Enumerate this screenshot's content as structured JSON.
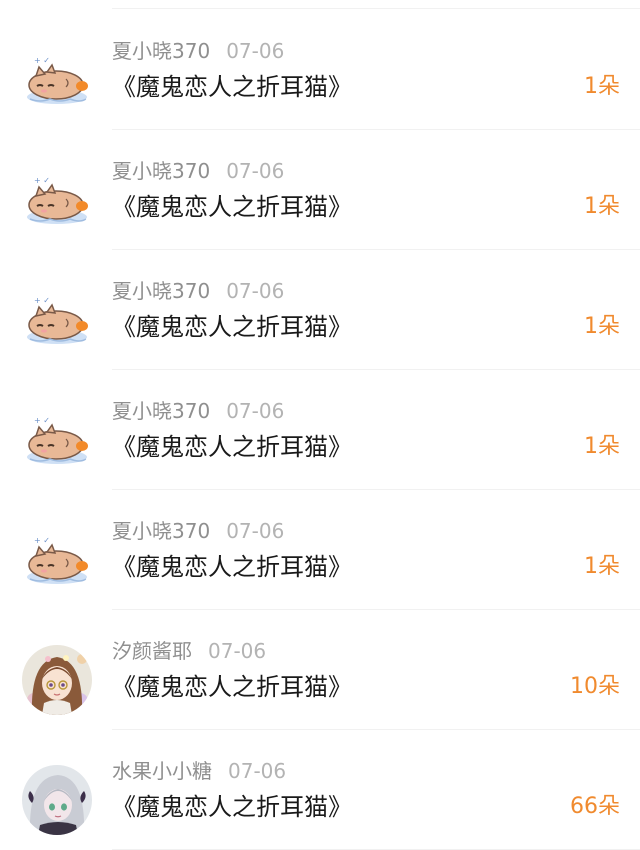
{
  "rows": [
    {
      "user": "夏小晓370",
      "date": "07-06",
      "title": "《魔鬼恋人之折耳猫》",
      "amount": "1朵",
      "avatar": "cat-sticker"
    },
    {
      "user": "夏小晓370",
      "date": "07-06",
      "title": "《魔鬼恋人之折耳猫》",
      "amount": "1朵",
      "avatar": "cat-sticker"
    },
    {
      "user": "夏小晓370",
      "date": "07-06",
      "title": "《魔鬼恋人之折耳猫》",
      "amount": "1朵",
      "avatar": "cat-sticker"
    },
    {
      "user": "夏小晓370",
      "date": "07-06",
      "title": "《魔鬼恋人之折耳猫》",
      "amount": "1朵",
      "avatar": "cat-sticker"
    },
    {
      "user": "夏小晓370",
      "date": "07-06",
      "title": "《魔鬼恋人之折耳猫》",
      "amount": "1朵",
      "avatar": "cat-sticker"
    },
    {
      "user": "汐颜酱耶",
      "date": "07-06",
      "title": "《魔鬼恋人之折耳猫》",
      "amount": "10朵",
      "avatar": "anime-girl-brown"
    },
    {
      "user": "水果小小糖",
      "date": "07-06",
      "title": "《魔鬼恋人之折耳猫》",
      "amount": "66朵",
      "avatar": "anime-girl-silver"
    }
  ],
  "colors": {
    "accent": "#f08a2e",
    "username": "#8f8f8f",
    "date": "#b3b3b3",
    "title": "#1a1a1a"
  }
}
